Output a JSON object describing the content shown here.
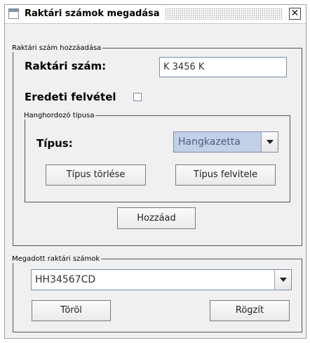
{
  "window": {
    "title": "Raktári számok megadása",
    "close_glyph": "✕"
  },
  "add_group": {
    "legend": "Raktári szám hozzáadása",
    "number_label": "Raktári szám:",
    "number_value": "K 3456 K",
    "original_label": "Eredeti felvétel",
    "original_checked": false,
    "add_button": "Hozzáad"
  },
  "medium_group": {
    "legend": "Hanghordozó típusa",
    "type_label": "Típus:",
    "type_selected": "Hangkazetta",
    "delete_button": "Típus törlése",
    "create_button": "Típus felvitele"
  },
  "list_group": {
    "legend": "Megadott raktári számok",
    "selected": "HH34567CD",
    "delete_button": "Töröl",
    "save_button": "Rögzít"
  },
  "colors": {
    "window_bg": "#f0f0f0",
    "title_icon": "#7f95b8",
    "selected_combo_bg": "#c4cfe8",
    "selected_combo_text": "#4e5f82"
  }
}
